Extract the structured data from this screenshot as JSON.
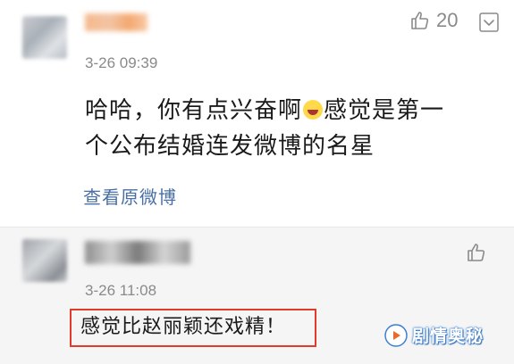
{
  "comment": {
    "timestamp": "3-26 09:39",
    "text_part1": "哈哈，你有点兴奋啊",
    "emoji": "laughing-face",
    "text_part2": "感觉是第一个公布结婚连发微博的名星",
    "view_original_label": "查看原微博",
    "like_count": "20"
  },
  "reply": {
    "timestamp": "3-26 11:08",
    "text": "感觉比赵丽颖还戏精！"
  },
  "watermark": {
    "text": "剧情奥秘"
  },
  "colors": {
    "link": "#4a6fa5",
    "highlight_border": "#e23b2e",
    "meta_gray": "#8a8a8a"
  }
}
